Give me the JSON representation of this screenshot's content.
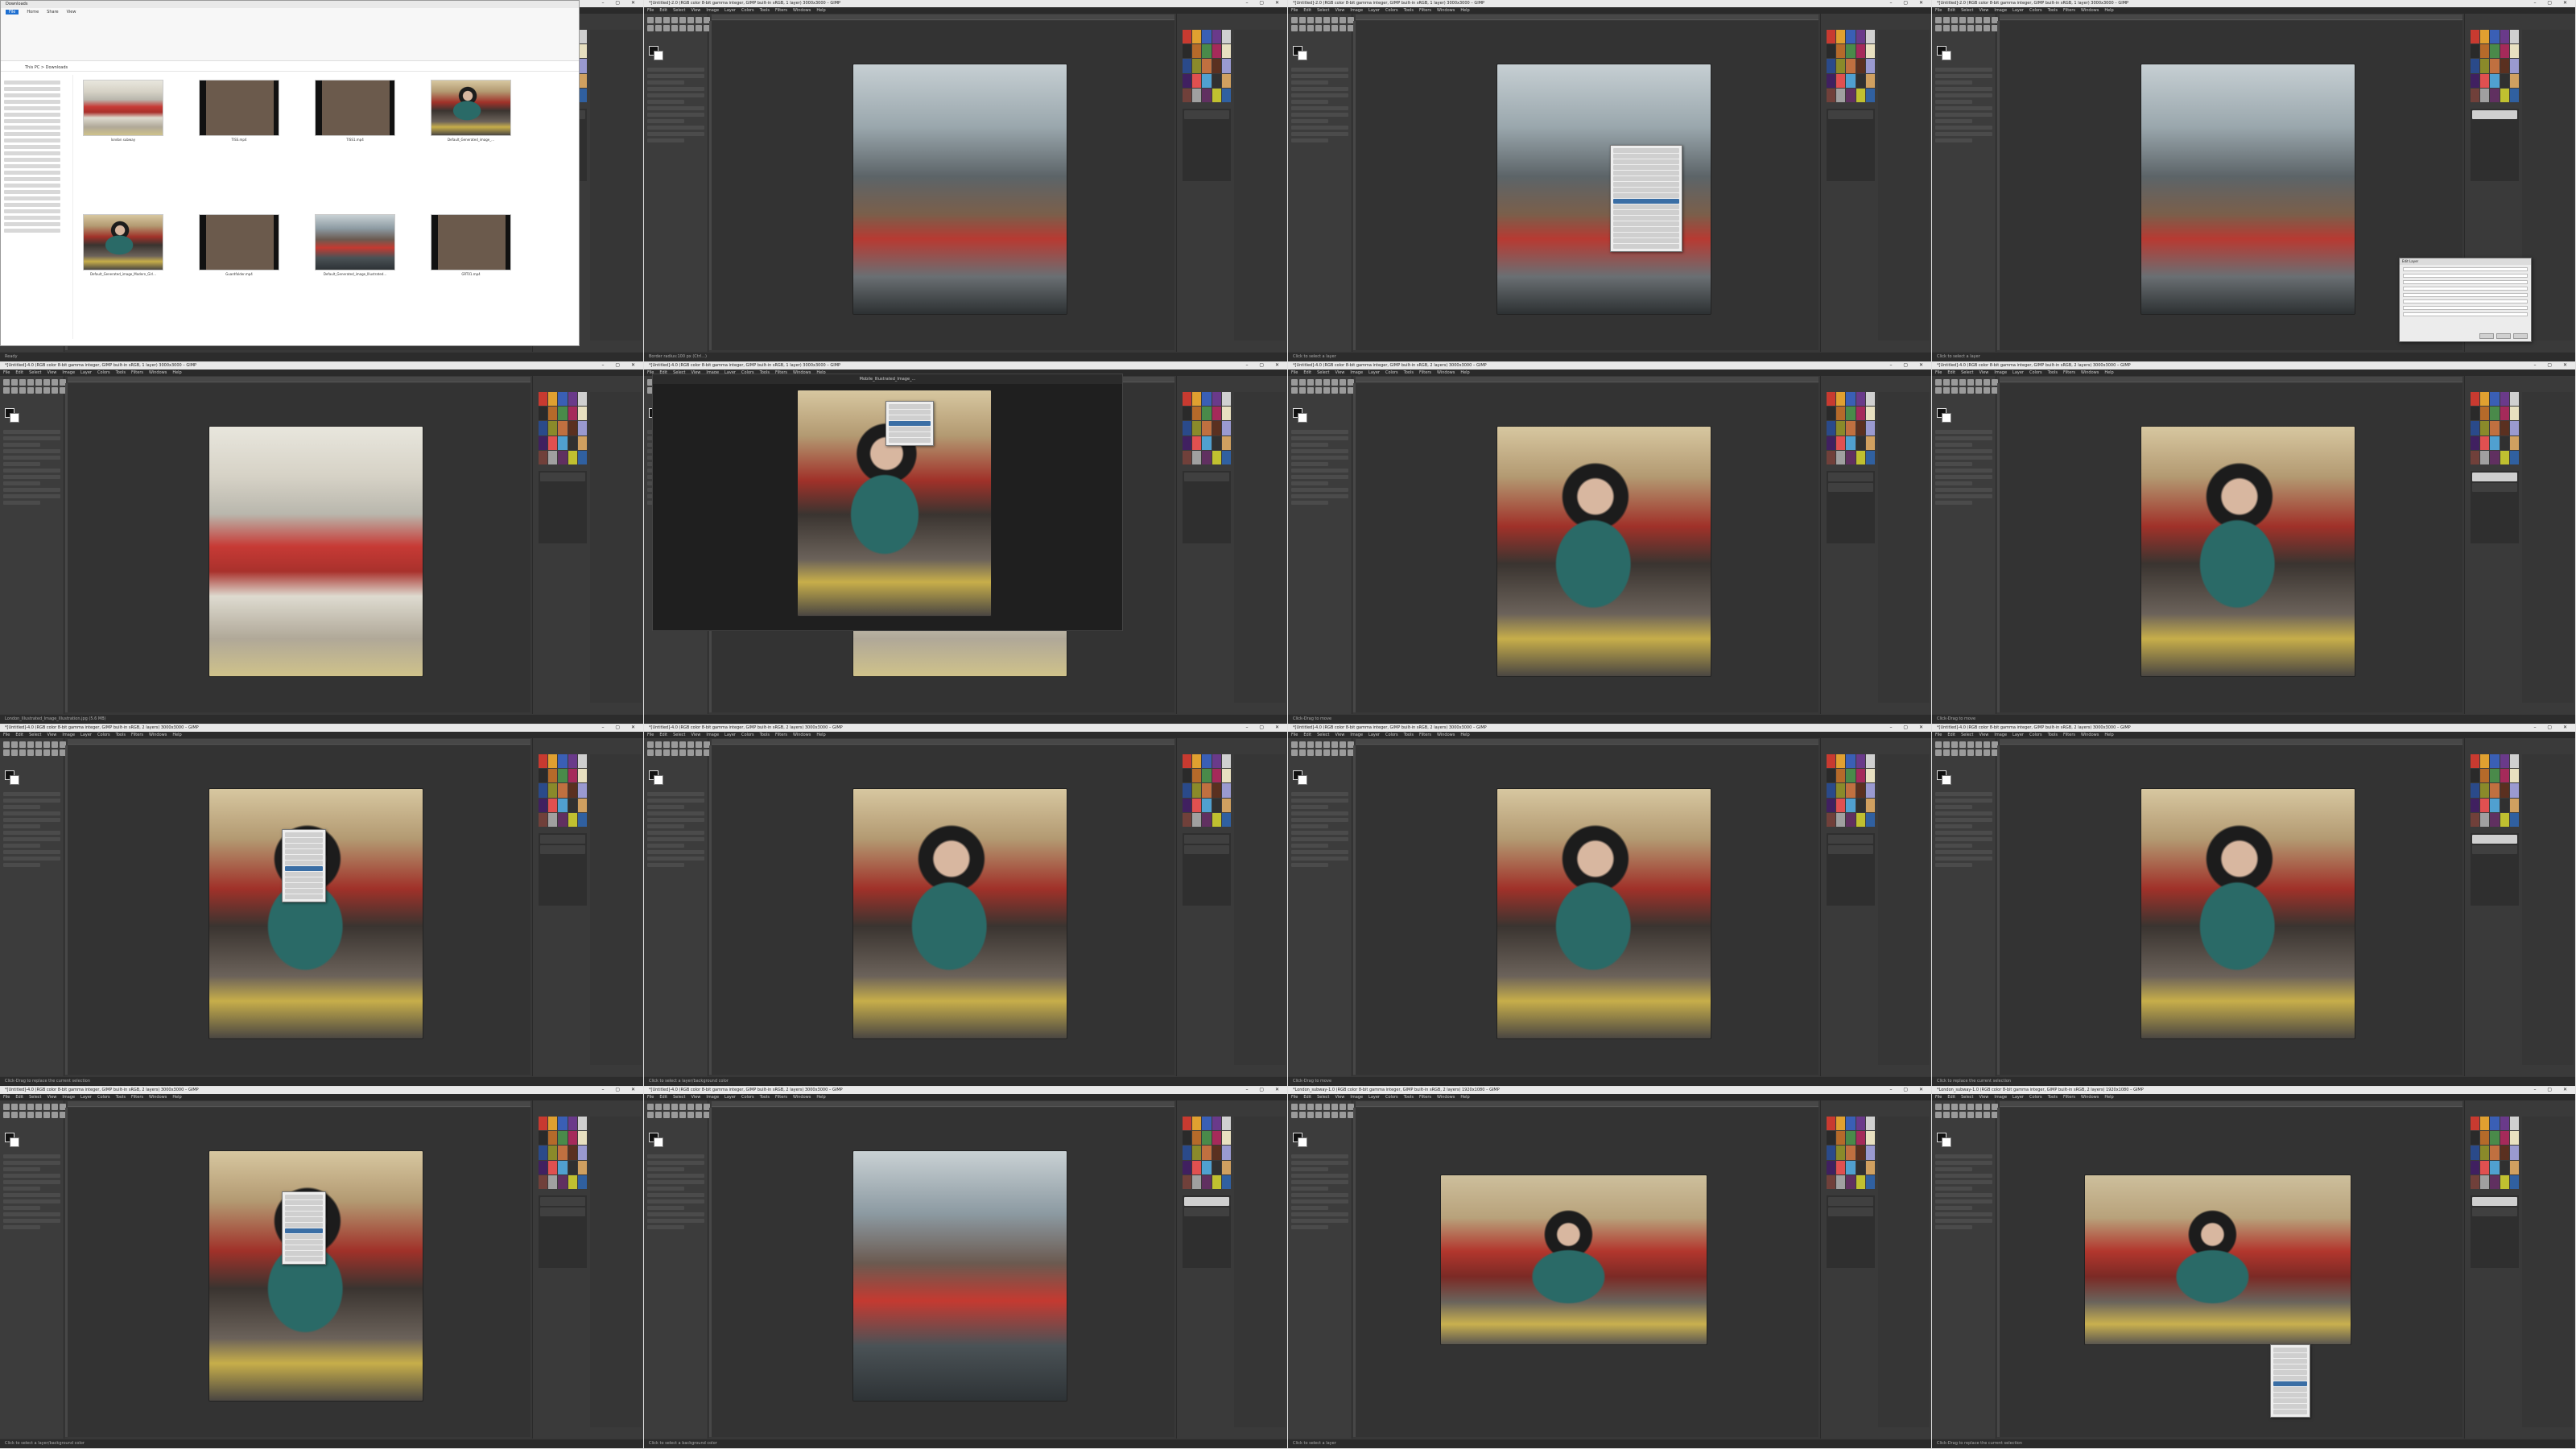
{
  "grid": {
    "tiles": [
      {
        "title": "*[Untitled]-2.0 (RGB color 8-bit gamma integer, GIMP built-in sRGB, 1 layer) 3000x3000 – GIMP",
        "view": "explorer-over-gimp",
        "image": "img-big-ben",
        "status": "Ready"
      },
      {
        "title": "*[Untitled]-2.0 (RGB color 8-bit gamma integer, GIMP built-in sRGB, 1 layer) 3000x3000 – GIMP",
        "view": "gimp",
        "image": "img-big-ben",
        "status": "Border radius:100 px (Ctrl...)"
      },
      {
        "title": "*[Untitled]-2.0 (RGB color 8-bit gamma integer, GIMP built-in sRGB, 1 layer) 3000x3000 – GIMP",
        "view": "gimp-menu",
        "image": "img-big-ben",
        "status": "Click to select a layer"
      },
      {
        "title": "*[Untitled]-2.0 (RGB color 8-bit gamma integer, GIMP built-in sRGB, 1 layer) 3000x3000 – GIMP",
        "view": "gimp-dialog",
        "image": "img-big-ben",
        "status": "Click to select a layer"
      },
      {
        "title": "*[Untitled]-4.0 (RGB color 8-bit gamma integer, GIMP built-in sRGB, 1 layer) 3000x3000 – GIMP",
        "view": "gimp",
        "image": "img-train",
        "status": "London_Illustrated_Image_Illustration.jpg (5.6 MB)"
      },
      {
        "title": "*[Untitled]-4.0 (RGB color 8-bit gamma integer, GIMP built-in sRGB, 1 layer) 3000x3000 – GIMP",
        "view": "viewer",
        "image": "img-girl",
        "status": ""
      },
      {
        "title": "*[Untitled]-4.0 (RGB color 8-bit gamma integer, GIMP built-in sRGB, 2 layers) 3000x3000 – GIMP",
        "view": "gimp",
        "image": "img-girl",
        "status": "Click-Drag to move"
      },
      {
        "title": "*[Untitled]-4.0 (RGB color 8-bit gamma integer, GIMP built-in sRGB, 2 layers) 3000x3000 – GIMP",
        "view": "gimp",
        "image": "img-girl",
        "status": "Click-Drag to move"
      },
      {
        "title": "*[Untitled]-4.0 (RGB color 8-bit gamma integer, GIMP built-in sRGB, 2 layers) 3000x3000 – GIMP",
        "view": "gimp-menu",
        "image": "img-girl",
        "status": "Click-Drag to replace the current selection"
      },
      {
        "title": "*[Untitled]-4.0 (RGB color 8-bit gamma integer, GIMP built-in sRGB, 2 layers) 3000x3000 – GIMP",
        "view": "gimp",
        "image": "img-girl",
        "status": "Click to select a layer/background color"
      },
      {
        "title": "*[Untitled]-4.0 (RGB color 8-bit gamma integer, GIMP built-in sRGB, 2 layers) 3000x3000 – GIMP",
        "view": "gimp",
        "image": "img-girl",
        "status": "Click-Drag to move"
      },
      {
        "title": "*[Untitled]-4.0 (RGB color 8-bit gamma integer, GIMP built-in sRGB, 2 layers) 3000x3000 – GIMP",
        "view": "gimp",
        "image": "img-girl",
        "status": "Click to replace the current selection"
      },
      {
        "title": "*[Untitled]-4.0 (RGB color 8-bit gamma integer, GIMP built-in sRGB, 2 layers) 3000x3000 – GIMP",
        "view": "gimp-menu",
        "image": "img-girl",
        "status": "Click to select a layer/background color"
      },
      {
        "title": "*[Untitled]-4.0 (RGB color 8-bit gamma integer, GIMP built-in sRGB, 2 layers) 3000x3000 – GIMP",
        "view": "gimp",
        "image": "img-street",
        "status": "Click to select a background color"
      },
      {
        "title": "*London_subway-1.0 (RGB color 8-bit gamma integer, GIMP built-in sRGB, 2 layers) 1920x1080 – GIMP",
        "view": "gimp-wide",
        "image": "img-wide",
        "status": "Click to select a layer"
      },
      {
        "title": "*London_subway-1.0 (RGB color 8-bit gamma integer, GIMP built-in sRGB, 2 layers) 1920x1080 – GIMP",
        "view": "gimp-wide-menu",
        "image": "img-wide",
        "status": "Click-Drag to replace the current selection"
      }
    ]
  },
  "gimp": {
    "menu": [
      "File",
      "Edit",
      "Select",
      "View",
      "Image",
      "Layer",
      "Colors",
      "Tools",
      "Filters",
      "Windows",
      "Help"
    ]
  },
  "explorer": {
    "title": "Downloads",
    "tabs": [
      "File",
      "Home",
      "Share",
      "View"
    ],
    "address": "This PC > Downloads",
    "files": [
      {
        "name": "london subway"
      },
      {
        "name": "TISS.mp4"
      },
      {
        "name": "TISS1.mp4"
      },
      {
        "name": "Default_Generated_image_..."
      },
      {
        "name": "Default_Generated_image_Modern_Girl..."
      },
      {
        "name": "Guardfolder.mp4"
      },
      {
        "name": "Default_Generated_image_Illustrated..."
      },
      {
        "name": "GRT01.mp4"
      }
    ]
  },
  "viewer": {
    "title": "Mobile_Illustrated_Image_..."
  },
  "dialog": {
    "title": "Edit Layer"
  },
  "colors": {
    "gimp_bg": "#383838",
    "dock_bg": "#3a3a3a",
    "accent": "#3a6ea5"
  }
}
